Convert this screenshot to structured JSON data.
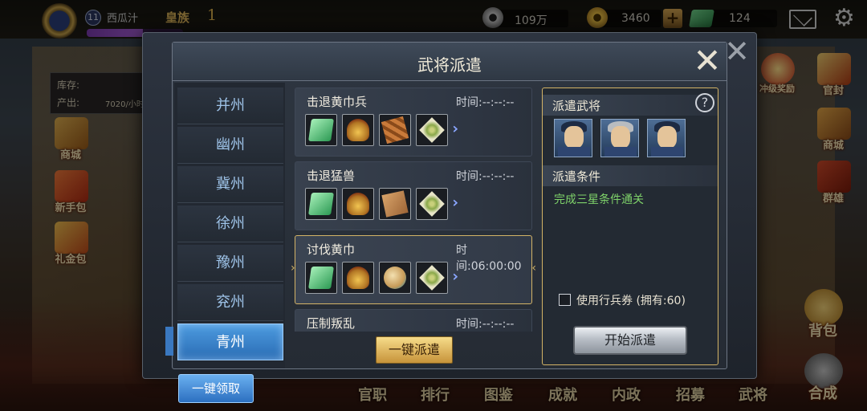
{
  "topbar": {
    "level": "11",
    "player_name": "西瓜汁",
    "player_title": "皇族",
    "vip": "1",
    "exp_progress": 0.58,
    "copper": "109万",
    "gold": "3460",
    "cash": "124",
    "icons": {
      "copper": "copper-coin-icon",
      "gold": "gold-coin-icon",
      "cash": "cash-icon",
      "mail": "mail-icon",
      "settings": "gear-icon"
    }
  },
  "info": {
    "stock_label": "库存:",
    "output_label": "产出:",
    "output_value": "7020/小时"
  },
  "side_left": [
    {
      "label": "商城"
    },
    {
      "label": "新手包"
    },
    {
      "label": "礼金包"
    }
  ],
  "side_right": [
    {
      "label": "冲级奖励"
    },
    {
      "label": "官封"
    },
    {
      "label": "商城"
    },
    {
      "label": "群雄"
    },
    {
      "label": "背包"
    },
    {
      "label": "合成"
    }
  ],
  "bottom_nav": [
    "官职",
    "排行",
    "图鉴",
    "成就",
    "内政",
    "招募",
    "武将"
  ],
  "modal": {
    "title": "武将派遣",
    "tabs": [
      "并州",
      "幽州",
      "冀州",
      "徐州",
      "豫州",
      "兖州",
      "青州"
    ],
    "active_tab": "青州",
    "missions": [
      {
        "name": "击退黄巾兵",
        "time": "时间:--:--:--",
        "items": [
          "jade-icon",
          "helmet-icon",
          "wood-icon",
          "rice-icon"
        ]
      },
      {
        "name": "击退猛兽",
        "time": "时间:--:--:--",
        "items": [
          "jade-icon",
          "helmet-icon",
          "scroll-icon",
          "rice-icon"
        ]
      },
      {
        "name": "讨伐黄巾",
        "time": "时间:06:00:00",
        "items": [
          "jade-icon",
          "helmet-icon",
          "shell-icon",
          "rice-icon"
        ]
      },
      {
        "name": "压制叛乱",
        "time": "时间:--:--:--"
      }
    ],
    "dispatch_all": "一键派遣",
    "right": {
      "generals_title": "派遣武将",
      "conditions_title": "派遣条件",
      "condition_text": "完成三星条件通关",
      "ticket_label": "使用行兵券 (拥有:60)",
      "start_button": "开始派遣"
    }
  },
  "collect_all": "一键领取"
}
